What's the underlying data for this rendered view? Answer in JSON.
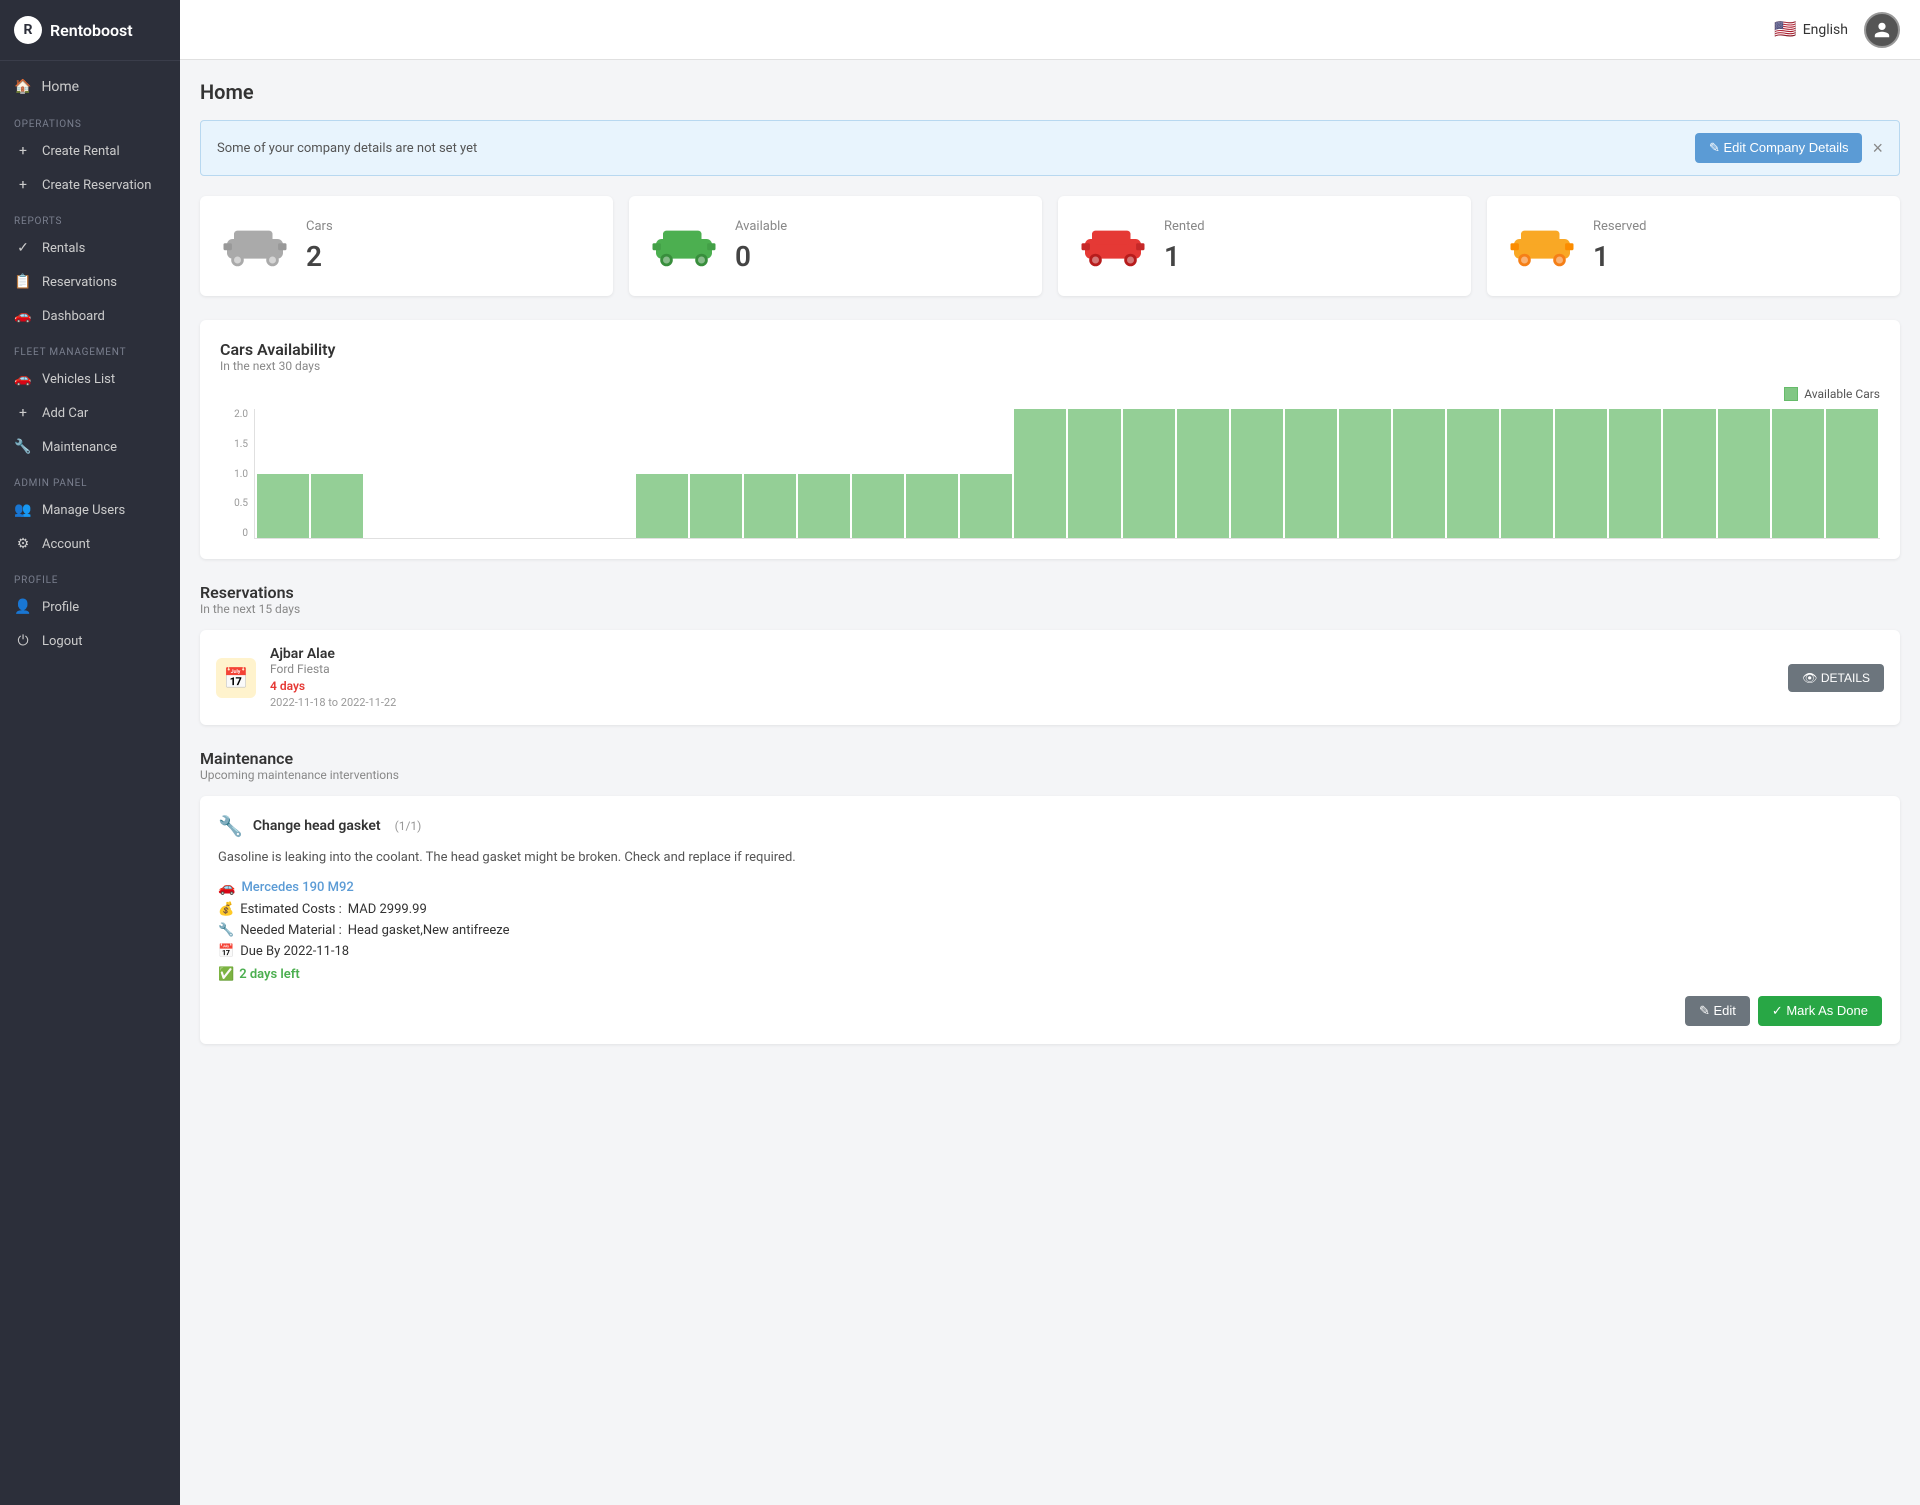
{
  "app": {
    "name": "Rentoboost",
    "logo_char": "R"
  },
  "topbar": {
    "language": "English",
    "flag": "🇺🇸"
  },
  "sidebar": {
    "home_label": "Home",
    "sections": [
      {
        "label": "OPERATIONS",
        "items": [
          {
            "id": "create-rental",
            "label": "Create Rental",
            "icon": "+"
          },
          {
            "id": "create-reservation",
            "label": "Create Reservation",
            "icon": "+"
          }
        ]
      },
      {
        "label": "REPORTS",
        "items": [
          {
            "id": "rentals",
            "label": "Rentals",
            "icon": "✓"
          },
          {
            "id": "reservations",
            "label": "Reservations",
            "icon": "📋"
          },
          {
            "id": "dashboard",
            "label": "Dashboard",
            "icon": "🚗"
          }
        ]
      },
      {
        "label": "FLEET MANAGEMENT",
        "items": [
          {
            "id": "vehicles-list",
            "label": "Vehicles List",
            "icon": "🚗"
          },
          {
            "id": "add-car",
            "label": "Add Car",
            "icon": "+"
          },
          {
            "id": "maintenance",
            "label": "Maintenance",
            "icon": "🔧"
          }
        ]
      },
      {
        "label": "ADMIN PANEL",
        "items": [
          {
            "id": "manage-users",
            "label": "Manage Users",
            "icon": "👥"
          },
          {
            "id": "account",
            "label": "Account",
            "icon": "⚙"
          }
        ]
      },
      {
        "label": "PROFILE",
        "items": [
          {
            "id": "profile",
            "label": "Profile",
            "icon": "👤"
          },
          {
            "id": "logout",
            "label": "Logout",
            "icon": "⏻"
          }
        ]
      }
    ]
  },
  "page_title": "Home",
  "alert": {
    "message": "Some of your company details are not set yet",
    "button_label": "✎ Edit Company Details"
  },
  "stats": [
    {
      "id": "cars",
      "label": "Cars",
      "value": "2",
      "car_color": "grey"
    },
    {
      "id": "available",
      "label": "Available",
      "value": "0",
      "car_color": "green"
    },
    {
      "id": "rented",
      "label": "Rented",
      "value": "1",
      "car_color": "red"
    },
    {
      "id": "reserved",
      "label": "Reserved",
      "value": "1",
      "car_color": "yellow"
    }
  ],
  "chart": {
    "title": "Cars Availability",
    "subtitle": "In the next 30 days",
    "legend": "Available Cars",
    "y_labels": [
      "2.0",
      "1.5",
      "1.0",
      "0.5",
      "0"
    ],
    "bars": [
      1,
      1,
      0,
      0,
      0,
      0,
      0,
      1,
      1,
      1,
      1,
      1,
      1,
      1,
      2,
      2,
      2,
      2,
      2,
      2,
      2,
      2,
      2,
      2,
      2,
      2,
      2,
      2,
      2,
      2
    ]
  },
  "reservations": {
    "title": "Reservations",
    "subtitle": "In the next 15 days",
    "items": [
      {
        "name": "Ajbar Alae",
        "car": "Ford Fiesta",
        "days": "4 days",
        "date_range": "2022-11-18 to 2022-11-22",
        "details_label": "👁 DETAILS"
      }
    ]
  },
  "maintenance": {
    "title": "Maintenance",
    "subtitle": "Upcoming maintenance interventions",
    "items": [
      {
        "icon": "🔧",
        "title": "Change head gasket",
        "counter": "(1/1)",
        "description": "Gasoline is leaking into the coolant. The head gasket might be broken. Check and replace if required.",
        "car_link": "Mercedes 190 M92",
        "estimated_costs": "MAD 2999.99",
        "needed_material": "Head gasket,New antifreeze",
        "due_by": "Due By 2022-11-18",
        "days_left": "2 days left",
        "edit_label": "✎ Edit",
        "done_label": "✓ Mark As Done"
      }
    ]
  }
}
